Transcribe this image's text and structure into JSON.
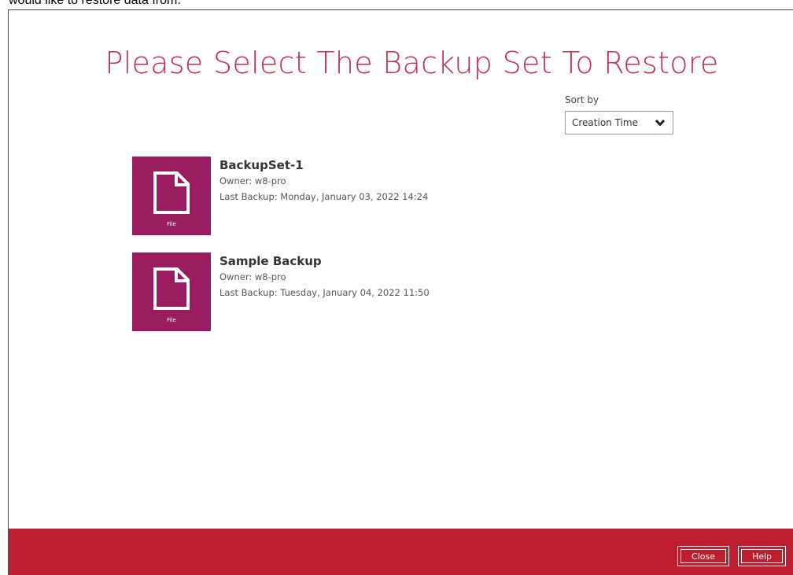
{
  "doc_caption": "would like to restore data from.",
  "title": "Please Select The Backup Set To Restore",
  "sort": {
    "label": "Sort by",
    "selected": "Creation Time"
  },
  "backup_sets": [
    {
      "name": "BackupSet-1",
      "owner": "Owner: w8-pro",
      "last_backup": "Last Backup: Monday, January 03, 2022 14:24",
      "type_label": "File"
    },
    {
      "name": "Sample Backup",
      "owner": "Owner: w8-pro",
      "last_backup": "Last Backup: Tuesday, January 04, 2022 11:50",
      "type_label": "File"
    }
  ],
  "footer": {
    "close_label": "Close",
    "help_label": "Help"
  },
  "colors": {
    "title": "#c2304f",
    "tile": "#9b1b60",
    "footer": "#be1e2d"
  },
  "icons": {
    "file": "file-icon",
    "dropdown": "chevron-down-icon"
  }
}
